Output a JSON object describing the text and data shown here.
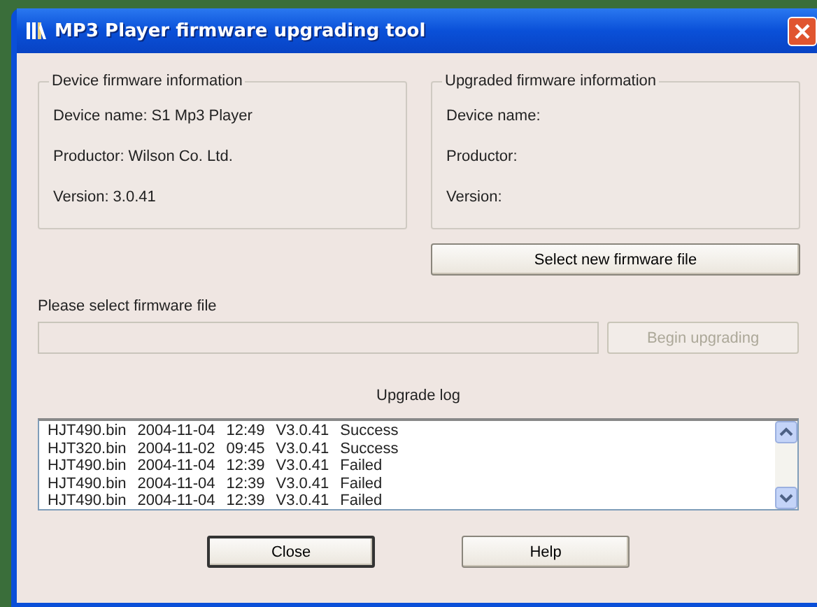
{
  "window": {
    "title": "MP3 Player firmware upgrading tool"
  },
  "groups": [
    {
      "title": "Device firmware information",
      "fields": [
        "Device name: S1 Mp3 Player",
        "Productor: Wilson Co. Ltd.",
        "Version: 3.0.41"
      ]
    },
    {
      "title": "Upgraded firmware information",
      "fields": [
        "Device name:",
        "Productor:",
        "Version:"
      ]
    }
  ],
  "select_button": {
    "label": "Select new firmware file",
    "disabled": false
  },
  "file_field": {
    "label": "Please select firmware file",
    "disabled": true
  },
  "begin_button": {
    "label": "Begin upgrading",
    "disabled": true
  },
  "log": {
    "title": "Upgrade log",
    "rows": [
      {
        "file": "HJT490.bin",
        "date": "2004-11-04",
        "time": "12:49",
        "version": "V3.0.41",
        "status": "Success"
      },
      {
        "file": "HJT320.bin",
        "date": "2004-11-02",
        "time": "09:45",
        "version": "V3.0.41",
        "status": "Success"
      },
      {
        "file": "HJT490.bin",
        "date": "2004-11-04",
        "time": "12:39",
        "version": "V3.0.41",
        "status": "Failed"
      },
      {
        "file": "HJT490.bin",
        "date": "2004-11-04",
        "time": "12:39",
        "version": "V3.0.41",
        "status": "Failed"
      },
      {
        "file": "HJT490.bin",
        "date": "2004-11-04",
        "time": "12:39",
        "version": "V3.0.41",
        "status": "Failed"
      }
    ]
  },
  "buttons": [
    {
      "label": "Close",
      "focused": true
    },
    {
      "label": "Help",
      "focused": false
    }
  ]
}
